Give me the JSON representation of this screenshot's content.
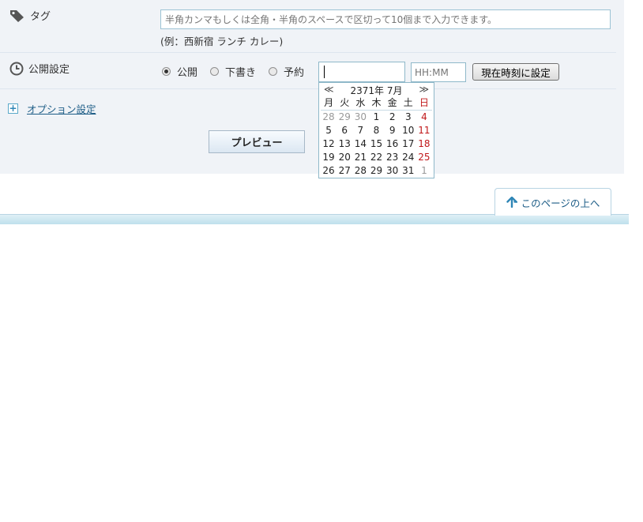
{
  "tag": {
    "label": "タグ",
    "input_placeholder": "半角カンマもしくは全角・半角のスペースで区切って10個まで入力できます。",
    "example": "(例：西新宿 ランチ カレー)"
  },
  "publish": {
    "label": "公開設定",
    "options": [
      "公開",
      "下書き",
      "予約"
    ],
    "selected": "公開",
    "date_value": "",
    "time_placeholder": "HH:MM",
    "now_button": "現在時刻に設定"
  },
  "option": {
    "label": "オプション設定"
  },
  "preview_button": "プレビュー",
  "calendar": {
    "prev": "≪",
    "title": "2371年 7月",
    "next": "≫",
    "weekdays": [
      "月",
      "火",
      "水",
      "木",
      "金",
      "土",
      "日"
    ],
    "weeks": [
      [
        "28",
        "29",
        "30",
        "1",
        "2",
        "3",
        "4"
      ],
      [
        "5",
        "6",
        "7",
        "8",
        "9",
        "10",
        "11"
      ],
      [
        "12",
        "13",
        "14",
        "15",
        "16",
        "17",
        "18"
      ],
      [
        "19",
        "20",
        "21",
        "22",
        "23",
        "24",
        "25"
      ],
      [
        "26",
        "27",
        "28",
        "29",
        "30",
        "31",
        "1"
      ]
    ]
  },
  "page_top": {
    "label": "このページの上へ"
  },
  "colors": {
    "accent": "#1c5c86",
    "sunday": "#c0181a",
    "panel_bg": "#f0f3f7"
  }
}
